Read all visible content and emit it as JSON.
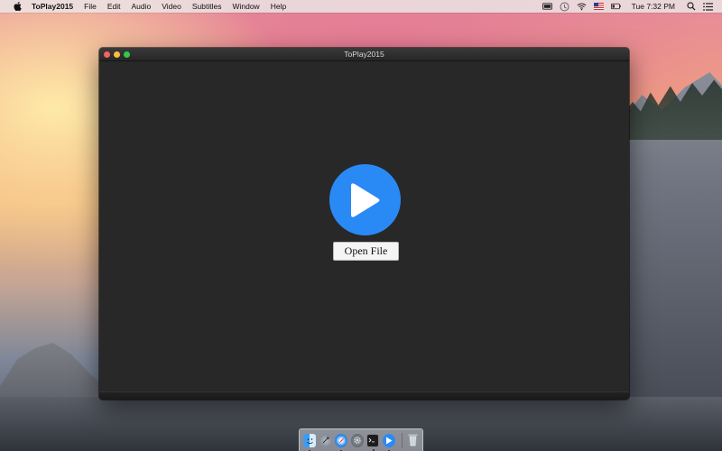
{
  "menubar": {
    "app_name": "ToPlay2015",
    "menus": [
      "File",
      "Edit",
      "Audio",
      "Video",
      "Subtitles",
      "Window",
      "Help"
    ],
    "clock": "Tue 7:32 PM",
    "status_icons": [
      "battery-meter-icon",
      "time-machine-icon",
      "wifi-icon",
      "us-flag-icon",
      "battery-icon",
      "spotlight-search-icon",
      "notification-center-icon"
    ]
  },
  "window": {
    "title": "ToPlay2015",
    "open_file_label": "Open File",
    "play_button_color": "#2a8af5",
    "background_color": "#282828"
  },
  "dock": {
    "apps": [
      "finder-icon",
      "launchpad-icon",
      "safari-icon",
      "system-preferences-icon",
      "terminal-icon",
      "toplay-icon"
    ],
    "trash": "trash-icon"
  }
}
